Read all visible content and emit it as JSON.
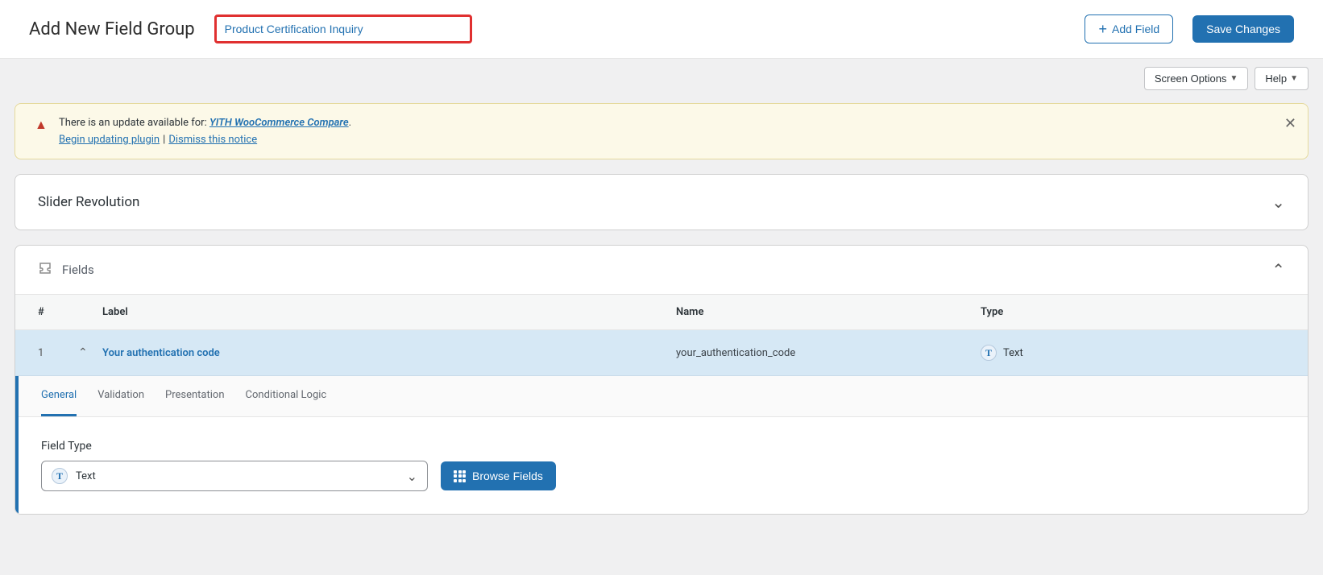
{
  "header": {
    "title": "Add New Field Group",
    "input_value": "Product Certification Inquiry",
    "add_field_label": "Add Field",
    "save_label": "Save Changes"
  },
  "tabs": {
    "screen_options": "Screen Options",
    "help": "Help"
  },
  "notice": {
    "prefix": "There is an update available for: ",
    "plugin_link": "YITH WooCommerce Compare",
    "begin_update": "Begin updating plugin",
    "dismiss": "Dismiss this notice"
  },
  "panels": {
    "slider_rev": "Slider Revolution",
    "fields": "Fields"
  },
  "columns": {
    "num": "#",
    "label": "Label",
    "name": "Name",
    "type": "Type"
  },
  "rows": [
    {
      "num": "1",
      "label": "Your authentication code",
      "name": "your_authentication_code",
      "type": "Text"
    }
  ],
  "settings": {
    "tabs": {
      "general": "General",
      "validation": "Validation",
      "presentation": "Presentation",
      "conditional": "Conditional Logic"
    },
    "field_type_label": "Field Type",
    "field_type_value": "Text",
    "browse_label": "Browse Fields"
  }
}
